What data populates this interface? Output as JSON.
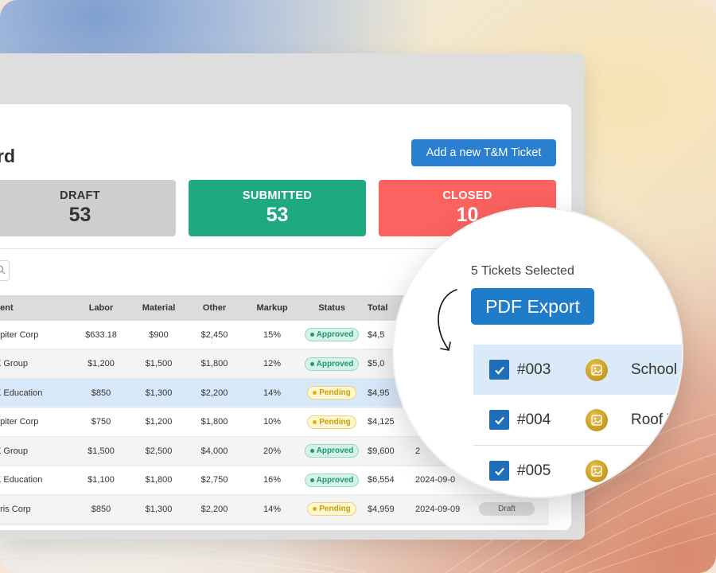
{
  "header": {
    "title_partial": "rd",
    "add_button_label": "Add a new T&M Ticket"
  },
  "stats": [
    {
      "label": "DRAFT",
      "value": "53",
      "color": "#cecece"
    },
    {
      "label": "SUBMITTED",
      "value": "53",
      "color": "#1fa980"
    },
    {
      "label": "CLOSED",
      "value": "10",
      "color": "#fb6260"
    }
  ],
  "table": {
    "columns": [
      "lient",
      "Labor",
      "Material",
      "Other",
      "Markup",
      "Status",
      "Total"
    ],
    "rows": [
      {
        "client": "upiter Corp",
        "labor": "$633.18",
        "material": "$900",
        "other": "$2,450",
        "markup": "15%",
        "status": "Approved",
        "total": "$4,5",
        "date": "",
        "state": ""
      },
      {
        "client": "X Group",
        "labor": "$1,200",
        "material": "$1,500",
        "other": "$1,800",
        "markup": "12%",
        "status": "Approved",
        "total": "$5,0",
        "date": "",
        "state": ""
      },
      {
        "client": "K Education",
        "labor": "$850",
        "material": "$1,300",
        "other": "$2,200",
        "markup": "14%",
        "status": "Pending",
        "total": "$4,95",
        "date": "",
        "state": ""
      },
      {
        "client": "upiter Corp",
        "labor": "$750",
        "material": "$1,200",
        "other": "$1,800",
        "markup": "10%",
        "status": "Pending",
        "total": "$4,125",
        "date": "",
        "state": ""
      },
      {
        "client": "X Group",
        "labor": "$1,500",
        "material": "$2,500",
        "other": "$4,000",
        "markup": "20%",
        "status": "Approved",
        "total": "$9,600",
        "date": "2",
        "state": ""
      },
      {
        "client": "K Education",
        "labor": "$1,100",
        "material": "$1,800",
        "other": "$2,750",
        "markup": "16%",
        "status": "Approved",
        "total": "$6,554",
        "date": "2024-09-0",
        "state": ""
      },
      {
        "client": "bris Corp",
        "labor": "$850",
        "material": "$1,300",
        "other": "$2,200",
        "markup": "14%",
        "status": "Pending",
        "total": "$4,959",
        "date": "2024-09-09",
        "state": "Draft"
      }
    ]
  },
  "magnifier": {
    "selected_text": "5 Tickets Selected",
    "export_label": "PDF Export",
    "tickets": [
      {
        "id": "#003",
        "name": "School I"
      },
      {
        "id": "#004",
        "name": "Roof T"
      },
      {
        "id": "#005",
        "name": ""
      }
    ]
  },
  "colors": {
    "accent": "#2a7fd0",
    "approved": "#1f9a6e",
    "pending": "#e0b000"
  }
}
